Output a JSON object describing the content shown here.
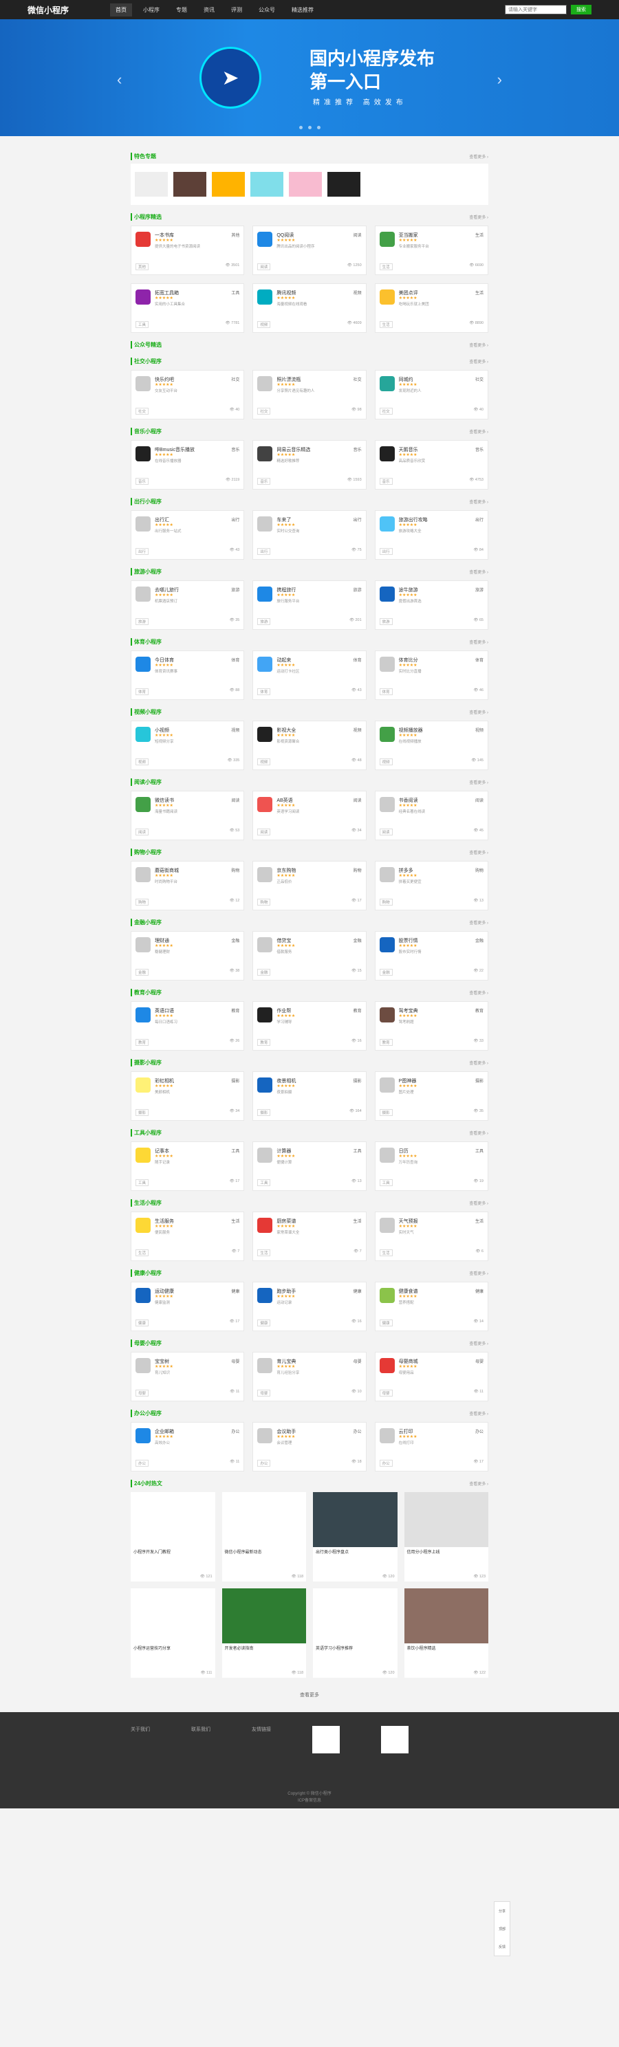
{
  "header": {
    "logo": "微信小程序",
    "nav": [
      "首页",
      "小程序",
      "专题",
      "资讯",
      "评测",
      "公众号",
      "精选推荐"
    ],
    "search_placeholder": "请输入关键字",
    "search_btn": "搜索"
  },
  "banner": {
    "line1": "国内小程序发布",
    "line2": "第一入口",
    "sub": "精准推荐 高效发布"
  },
  "sections": [
    {
      "title": "特色专题",
      "more": "查看更多"
    },
    {
      "title": "小程序精选",
      "more": "查看更多",
      "cards": [
        {
          "name": "一本书库",
          "tag": "其他",
          "color": "#e53935",
          "desc": "提供大量的电子书资源阅读",
          "views": "3501"
        },
        {
          "name": "QQ阅读",
          "tag": "阅读",
          "color": "#1e88e5",
          "desc": "腾讯出品的阅读小程序",
          "views": "1250"
        },
        {
          "name": "亚当搬家",
          "tag": "生活",
          "color": "#43a047",
          "desc": "专业搬家服务平台",
          "views": "6690"
        },
        {
          "name": "拓宽工具箱",
          "tag": "工具",
          "color": "#8e24aa",
          "desc": "实用的小工具集合",
          "views": "7781"
        },
        {
          "name": "腾讯视频",
          "tag": "视频",
          "color": "#00acc1",
          "desc": "海量视频在线观看",
          "views": "4609"
        },
        {
          "name": "美团点评",
          "tag": "生活",
          "color": "#fbc02d",
          "desc": "吃喝玩乐就上美团",
          "views": "8890"
        }
      ]
    },
    {
      "title": "公众号精选",
      "more": "查看更多"
    },
    {
      "title": "社交小程序",
      "more": "查看更多",
      "cards": [
        {
          "name": "快乐约吧",
          "tag": "社交",
          "color": "#ccc",
          "desc": "交友互动平台",
          "views": "40"
        },
        {
          "name": "照片漂流瓶",
          "tag": "社交",
          "color": "#ccc",
          "desc": "分享照片遇见有趣的人",
          "views": "98"
        },
        {
          "name": "同城约",
          "tag": "社交",
          "color": "#26a69a",
          "desc": "发现附近的人",
          "views": "40"
        }
      ]
    },
    {
      "title": "音乐小程序",
      "more": "查看更多",
      "cards": [
        {
          "name": "哔Bmusic音乐播放",
          "tag": "音乐",
          "color": "#212121",
          "desc": "在线音乐播放器",
          "views": "2119"
        },
        {
          "name": "网易云音乐精选",
          "tag": "音乐",
          "color": "#424242",
          "desc": "精选好歌推荐",
          "views": "1593"
        },
        {
          "name": "天鹅音乐",
          "tag": "音乐",
          "color": "#212121",
          "desc": "高品质音乐欣赏",
          "views": "4753"
        }
      ]
    },
    {
      "title": "出行小程序",
      "more": "查看更多",
      "cards": [
        {
          "name": "出行汇",
          "tag": "出行",
          "color": "#ccc",
          "desc": "出行服务一站式",
          "views": "43"
        },
        {
          "name": "车来了",
          "tag": "出行",
          "color": "#ccc",
          "desc": "实时公交查询",
          "views": "75"
        },
        {
          "name": "旅游出行攻略",
          "tag": "出行",
          "color": "#4fc3f7",
          "desc": "旅游攻略大全",
          "views": "84"
        }
      ]
    },
    {
      "title": "旅游小程序",
      "more": "查看更多",
      "cards": [
        {
          "name": "去哪儿旅行",
          "tag": "旅游",
          "color": "#ccc",
          "desc": "机票酒店预订",
          "views": "35"
        },
        {
          "name": "携程旅行",
          "tag": "旅游",
          "color": "#1e88e5",
          "desc": "旅行服务平台",
          "views": "201"
        },
        {
          "name": "途牛旅游",
          "tag": "旅游",
          "color": "#1565c0",
          "desc": "度假出游首选",
          "views": "65"
        }
      ]
    },
    {
      "title": "体育小程序",
      "more": "查看更多",
      "cards": [
        {
          "name": "今日体育",
          "tag": "体育",
          "color": "#1e88e5",
          "desc": "体育资讯赛事",
          "views": "88"
        },
        {
          "name": "动起来",
          "tag": "体育",
          "color": "#42a5f5",
          "desc": "运动打卡社区",
          "views": "43"
        },
        {
          "name": "体育比分",
          "tag": "体育",
          "color": "#ccc",
          "desc": "实时比分直播",
          "views": "46"
        }
      ]
    },
    {
      "title": "视频小程序",
      "more": "查看更多",
      "cards": [
        {
          "name": "小视频",
          "tag": "视频",
          "color": "#26c6da",
          "desc": "短视频分享",
          "views": "335"
        },
        {
          "name": "影视大全",
          "tag": "视频",
          "color": "#212121",
          "desc": "影视资源聚合",
          "views": "48"
        },
        {
          "name": "视频播放器",
          "tag": "视频",
          "color": "#43a047",
          "desc": "在线视频播放",
          "views": "145"
        }
      ]
    },
    {
      "title": "阅读小程序",
      "more": "查看更多",
      "cards": [
        {
          "name": "微信读书",
          "tag": "阅读",
          "color": "#43a047",
          "desc": "海量书籍阅读",
          "views": "53"
        },
        {
          "name": "AB英语",
          "tag": "阅读",
          "color": "#ef5350",
          "desc": "英语学习阅读",
          "views": "34"
        },
        {
          "name": "书香阅读",
          "tag": "阅读",
          "color": "#ccc",
          "desc": "经典名著在线读",
          "views": "45"
        }
      ]
    },
    {
      "title": "购物小程序",
      "more": "查看更多",
      "cards": [
        {
          "name": "蘑菇街商城",
          "tag": "购物",
          "color": "#ccc",
          "desc": "时尚购物平台",
          "views": "12"
        },
        {
          "name": "京东购物",
          "tag": "购物",
          "color": "#ccc",
          "desc": "正品低价",
          "views": "17"
        },
        {
          "name": "拼多多",
          "tag": "购物",
          "color": "#ccc",
          "desc": "拼着买更便宜",
          "views": "13"
        }
      ]
    },
    {
      "title": "金融小程序",
      "more": "查看更多",
      "cards": [
        {
          "name": "理财通",
          "tag": "金融",
          "color": "#ccc",
          "desc": "稳健理财",
          "views": "38"
        },
        {
          "name": "借贷宝",
          "tag": "金融",
          "color": "#ccc",
          "desc": "借款服务",
          "views": "15"
        },
        {
          "name": "股票行情",
          "tag": "金融",
          "color": "#1565c0",
          "desc": "股市实时行情",
          "views": "22"
        }
      ]
    },
    {
      "title": "教育小程序",
      "more": "查看更多",
      "cards": [
        {
          "name": "英语口语",
          "tag": "教育",
          "color": "#1e88e5",
          "desc": "每日口语练习",
          "views": "26"
        },
        {
          "name": "作业帮",
          "tag": "教育",
          "color": "#212121",
          "desc": "学习辅导",
          "views": "16"
        },
        {
          "name": "驾考宝典",
          "tag": "教育",
          "color": "#6d4c41",
          "desc": "驾考刷题",
          "views": "33"
        }
      ]
    },
    {
      "title": "摄影小程序",
      "more": "查看更多",
      "cards": [
        {
          "name": "彩虹相机",
          "tag": "摄影",
          "color": "#fff176",
          "desc": "美颜相机",
          "views": "34"
        },
        {
          "name": "夜景相机",
          "tag": "摄影",
          "color": "#1565c0",
          "desc": "夜景拍摄",
          "views": "164"
        },
        {
          "name": "P图神器",
          "tag": "摄影",
          "color": "#ccc",
          "desc": "图片处理",
          "views": "35"
        }
      ]
    },
    {
      "title": "工具小程序",
      "more": "查看更多",
      "cards": [
        {
          "name": "记事本",
          "tag": "工具",
          "color": "#fdd835",
          "desc": "随手记录",
          "views": "17"
        },
        {
          "name": "计算器",
          "tag": "工具",
          "color": "#ccc",
          "desc": "便捷计算",
          "views": "13"
        },
        {
          "name": "日历",
          "tag": "工具",
          "color": "#ccc",
          "desc": "万年历查询",
          "views": "19"
        }
      ]
    },
    {
      "title": "生活小程序",
      "more": "查看更多",
      "cards": [
        {
          "name": "生活服务",
          "tag": "生活",
          "color": "#fdd835",
          "desc": "便民服务",
          "views": "7"
        },
        {
          "name": "厨房菜谱",
          "tag": "生活",
          "color": "#e53935",
          "desc": "家常菜谱大全",
          "views": "7"
        },
        {
          "name": "天气预报",
          "tag": "生活",
          "color": "#ccc",
          "desc": "实时天气",
          "views": "6"
        }
      ]
    },
    {
      "title": "健康小程序",
      "more": "查看更多",
      "cards": [
        {
          "name": "运动健康",
          "tag": "健康",
          "color": "#1565c0",
          "desc": "健康监测",
          "views": "17"
        },
        {
          "name": "跑步助手",
          "tag": "健康",
          "color": "#1565c0",
          "desc": "运动记录",
          "views": "16"
        },
        {
          "name": "健康食谱",
          "tag": "健康",
          "color": "#8bc34a",
          "desc": "营养搭配",
          "views": "14"
        }
      ]
    },
    {
      "title": "母婴小程序",
      "more": "查看更多",
      "cards": [
        {
          "name": "宝宝树",
          "tag": "母婴",
          "color": "#ccc",
          "desc": "育儿知识",
          "views": "11"
        },
        {
          "name": "育儿宝典",
          "tag": "母婴",
          "color": "#ccc",
          "desc": "育儿经验分享",
          "views": "10"
        },
        {
          "name": "母婴商城",
          "tag": "母婴",
          "color": "#e53935",
          "desc": "母婴用品",
          "views": "11"
        }
      ]
    },
    {
      "title": "办公小程序",
      "more": "查看更多",
      "cards": [
        {
          "name": "企业邮箱",
          "tag": "办公",
          "color": "#1e88e5",
          "desc": "高效办公",
          "views": "11"
        },
        {
          "name": "会议助手",
          "tag": "办公",
          "color": "#ccc",
          "desc": "会议管理",
          "views": "18"
        },
        {
          "name": "云打印",
          "tag": "办公",
          "color": "#ccc",
          "desc": "在线打印",
          "views": "17"
        }
      ]
    }
  ],
  "articles": {
    "title": "24小时热文",
    "more": "查看更多",
    "items": [
      {
        "title": "小程序开发入门教程",
        "views": "121"
      },
      {
        "title": "微信小程序最新动态",
        "views": "118"
      },
      {
        "title": "出行类小程序盘点",
        "views": "120"
      },
      {
        "title": "信用分小程序上线",
        "views": "123"
      },
      {
        "title": "小程序运营技巧分享",
        "views": "111"
      },
      {
        "title": "开发者必读指南",
        "views": "118"
      },
      {
        "title": "英语学习小程序推荐",
        "views": "120"
      },
      {
        "title": "茶饮小程序精选",
        "views": "122"
      }
    ]
  },
  "load_more": "查看更多",
  "footer": {
    "cols": [
      "关于我们",
      "联系我们",
      "友情链接"
    ],
    "copy1": "Copyright © 微信小程序",
    "copy2": "ICP备案信息"
  },
  "side": [
    "分享",
    "顶部",
    "反馈"
  ]
}
